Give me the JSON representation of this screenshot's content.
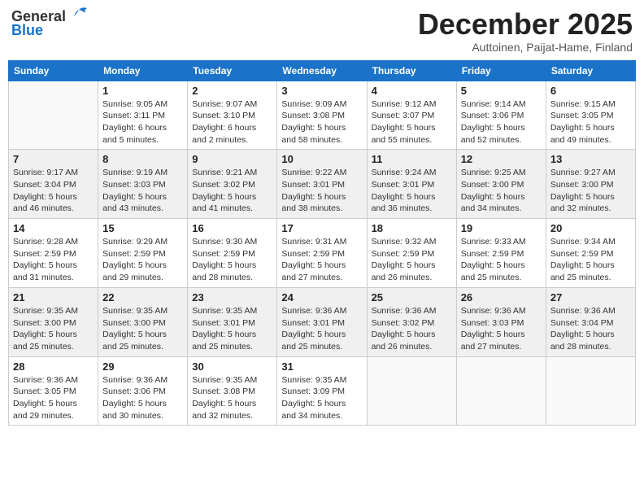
{
  "header": {
    "logo_general": "General",
    "logo_blue": "Blue",
    "month_title": "December 2025",
    "subtitle": "Auttoinen, Paijat-Hame, Finland"
  },
  "weekdays": [
    "Sunday",
    "Monday",
    "Tuesday",
    "Wednesday",
    "Thursday",
    "Friday",
    "Saturday"
  ],
  "weeks": [
    [
      {
        "day": "",
        "info": ""
      },
      {
        "day": "1",
        "info": "Sunrise: 9:05 AM\nSunset: 3:11 PM\nDaylight: 6 hours\nand 5 minutes."
      },
      {
        "day": "2",
        "info": "Sunrise: 9:07 AM\nSunset: 3:10 PM\nDaylight: 6 hours\nand 2 minutes."
      },
      {
        "day": "3",
        "info": "Sunrise: 9:09 AM\nSunset: 3:08 PM\nDaylight: 5 hours\nand 58 minutes."
      },
      {
        "day": "4",
        "info": "Sunrise: 9:12 AM\nSunset: 3:07 PM\nDaylight: 5 hours\nand 55 minutes."
      },
      {
        "day": "5",
        "info": "Sunrise: 9:14 AM\nSunset: 3:06 PM\nDaylight: 5 hours\nand 52 minutes."
      },
      {
        "day": "6",
        "info": "Sunrise: 9:15 AM\nSunset: 3:05 PM\nDaylight: 5 hours\nand 49 minutes."
      }
    ],
    [
      {
        "day": "7",
        "info": "Sunrise: 9:17 AM\nSunset: 3:04 PM\nDaylight: 5 hours\nand 46 minutes."
      },
      {
        "day": "8",
        "info": "Sunrise: 9:19 AM\nSunset: 3:03 PM\nDaylight: 5 hours\nand 43 minutes."
      },
      {
        "day": "9",
        "info": "Sunrise: 9:21 AM\nSunset: 3:02 PM\nDaylight: 5 hours\nand 41 minutes."
      },
      {
        "day": "10",
        "info": "Sunrise: 9:22 AM\nSunset: 3:01 PM\nDaylight: 5 hours\nand 38 minutes."
      },
      {
        "day": "11",
        "info": "Sunrise: 9:24 AM\nSunset: 3:01 PM\nDaylight: 5 hours\nand 36 minutes."
      },
      {
        "day": "12",
        "info": "Sunrise: 9:25 AM\nSunset: 3:00 PM\nDaylight: 5 hours\nand 34 minutes."
      },
      {
        "day": "13",
        "info": "Sunrise: 9:27 AM\nSunset: 3:00 PM\nDaylight: 5 hours\nand 32 minutes."
      }
    ],
    [
      {
        "day": "14",
        "info": "Sunrise: 9:28 AM\nSunset: 2:59 PM\nDaylight: 5 hours\nand 31 minutes."
      },
      {
        "day": "15",
        "info": "Sunrise: 9:29 AM\nSunset: 2:59 PM\nDaylight: 5 hours\nand 29 minutes."
      },
      {
        "day": "16",
        "info": "Sunrise: 9:30 AM\nSunset: 2:59 PM\nDaylight: 5 hours\nand 28 minutes."
      },
      {
        "day": "17",
        "info": "Sunrise: 9:31 AM\nSunset: 2:59 PM\nDaylight: 5 hours\nand 27 minutes."
      },
      {
        "day": "18",
        "info": "Sunrise: 9:32 AM\nSunset: 2:59 PM\nDaylight: 5 hours\nand 26 minutes."
      },
      {
        "day": "19",
        "info": "Sunrise: 9:33 AM\nSunset: 2:59 PM\nDaylight: 5 hours\nand 25 minutes."
      },
      {
        "day": "20",
        "info": "Sunrise: 9:34 AM\nSunset: 2:59 PM\nDaylight: 5 hours\nand 25 minutes."
      }
    ],
    [
      {
        "day": "21",
        "info": "Sunrise: 9:35 AM\nSunset: 3:00 PM\nDaylight: 5 hours\nand 25 minutes."
      },
      {
        "day": "22",
        "info": "Sunrise: 9:35 AM\nSunset: 3:00 PM\nDaylight: 5 hours\nand 25 minutes."
      },
      {
        "day": "23",
        "info": "Sunrise: 9:35 AM\nSunset: 3:01 PM\nDaylight: 5 hours\nand 25 minutes."
      },
      {
        "day": "24",
        "info": "Sunrise: 9:36 AM\nSunset: 3:01 PM\nDaylight: 5 hours\nand 25 minutes."
      },
      {
        "day": "25",
        "info": "Sunrise: 9:36 AM\nSunset: 3:02 PM\nDaylight: 5 hours\nand 26 minutes."
      },
      {
        "day": "26",
        "info": "Sunrise: 9:36 AM\nSunset: 3:03 PM\nDaylight: 5 hours\nand 27 minutes."
      },
      {
        "day": "27",
        "info": "Sunrise: 9:36 AM\nSunset: 3:04 PM\nDaylight: 5 hours\nand 28 minutes."
      }
    ],
    [
      {
        "day": "28",
        "info": "Sunrise: 9:36 AM\nSunset: 3:05 PM\nDaylight: 5 hours\nand 29 minutes."
      },
      {
        "day": "29",
        "info": "Sunrise: 9:36 AM\nSunset: 3:06 PM\nDaylight: 5 hours\nand 30 minutes."
      },
      {
        "day": "30",
        "info": "Sunrise: 9:35 AM\nSunset: 3:08 PM\nDaylight: 5 hours\nand 32 minutes."
      },
      {
        "day": "31",
        "info": "Sunrise: 9:35 AM\nSunset: 3:09 PM\nDaylight: 5 hours\nand 34 minutes."
      },
      {
        "day": "",
        "info": ""
      },
      {
        "day": "",
        "info": ""
      },
      {
        "day": "",
        "info": ""
      }
    ]
  ]
}
